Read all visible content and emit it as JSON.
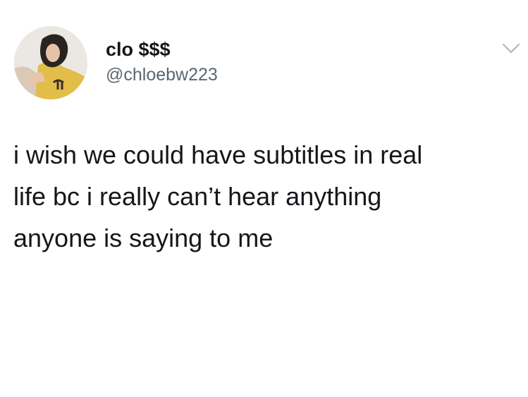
{
  "tweet": {
    "display_name": "clo $$$",
    "handle": "@chloebw223",
    "text": "i wish we could have subtitles in real\nlife bc i really can’t hear anything\nanyone is saying to me",
    "menu_icon": "chevron-down-icon"
  },
  "colors": {
    "background": "#ffffff",
    "primary_text": "#14171a",
    "secondary_text": "#5b6670",
    "caret": "#aab8c2"
  }
}
